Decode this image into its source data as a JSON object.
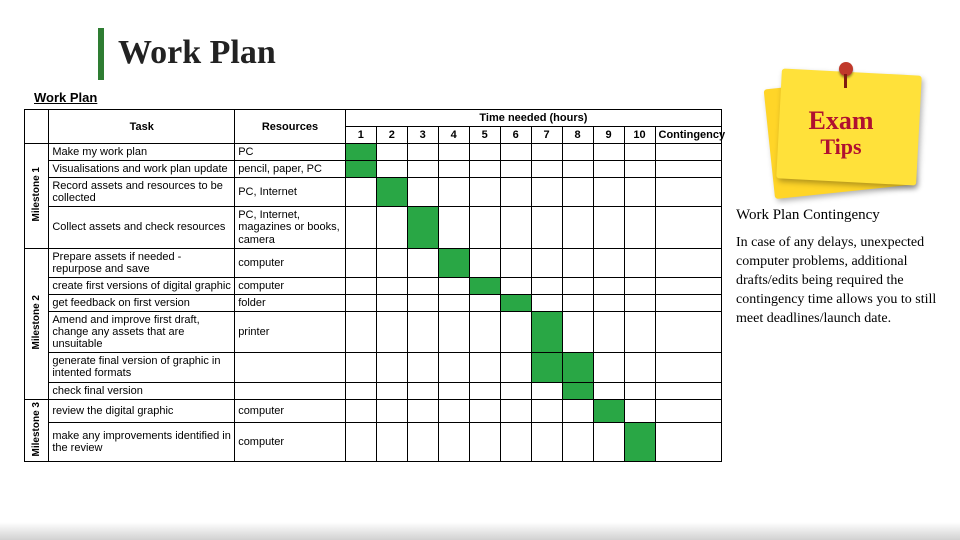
{
  "title": "Work Plan",
  "table_label": "Work Plan",
  "headers": {
    "task": "Task",
    "resources": "Resources",
    "time_group": "Time needed (hours)",
    "contingency": "Contingency",
    "hours": [
      "1",
      "2",
      "3",
      "4",
      "5",
      "6",
      "7",
      "8",
      "9",
      "10"
    ]
  },
  "milestones": [
    {
      "label": "Milestone 1",
      "start": 0,
      "span": 4
    },
    {
      "label": "Milestone 2",
      "start": 4,
      "span": 6
    },
    {
      "label": "Milestone 3",
      "start": 10,
      "span": 2
    }
  ],
  "rows": [
    {
      "task": "Make my work plan",
      "resource": "PC",
      "fill": [
        1
      ]
    },
    {
      "task": "Visualisations and work plan update",
      "resource": "pencil, paper, PC",
      "fill": [
        1
      ]
    },
    {
      "task": "Record assets and resources to be collected",
      "resource": "PC, Internet",
      "fill": [
        2
      ]
    },
    {
      "task": "Collect assets and check resources",
      "resource": "PC, Internet, magazines or books, camera",
      "fill": [
        3
      ]
    },
    {
      "task": "Prepare assets if needed - repurpose and save",
      "resource": "computer",
      "fill": [
        4
      ]
    },
    {
      "task": "create first versions of digital graphic",
      "resource": "computer",
      "fill": [
        5
      ]
    },
    {
      "task": "get feedback on first version",
      "resource": "folder",
      "fill": [
        6
      ]
    },
    {
      "task": "Amend and improve first draft, change any assets that are unsuitable",
      "resource": "printer",
      "fill": [
        7
      ]
    },
    {
      "task": "generate final version of graphic in intented formats",
      "resource": "",
      "fill": [
        7,
        8
      ]
    },
    {
      "task": "check final version",
      "resource": "",
      "fill": [
        8
      ]
    },
    {
      "task": "review the digital graphic",
      "resource": "computer",
      "fill": [
        9
      ]
    },
    {
      "task": "make any improvements identified in the review",
      "resource": "computer",
      "fill": [
        10
      ]
    }
  ],
  "sticky": {
    "line1": "Exam",
    "line2": "Tips"
  },
  "sidebar": {
    "heading": "Work Plan Contingency",
    "body": "In case of any delays, unexpected computer problems, additional drafts/edits being required the contingency time allows you to still meet deadlines/launch date."
  },
  "chart_data": {
    "type": "table",
    "title": "Work Plan",
    "columns": [
      "Task",
      "Resources",
      "1",
      "2",
      "3",
      "4",
      "5",
      "6",
      "7",
      "8",
      "9",
      "10",
      "Contingency"
    ],
    "milestones": {
      "Milestone 1": [
        "Make my work plan",
        "Visualisations and work plan update",
        "Record assets and resources to be collected",
        "Collect assets and check resources"
      ],
      "Milestone 2": [
        "Prepare assets if needed - repurpose and save",
        "create first versions of digital graphic",
        "get feedback on first version",
        "Amend and improve first draft, change any assets that are unsuitable",
        "generate final version of graphic in intented formats",
        "check final version"
      ],
      "Milestone 3": [
        "review the digital graphic",
        "make any improvements identified in the review"
      ]
    },
    "gantt": [
      {
        "task": "Make my work plan",
        "hours": [
          1
        ]
      },
      {
        "task": "Visualisations and work plan update",
        "hours": [
          1
        ]
      },
      {
        "task": "Record assets and resources to be collected",
        "hours": [
          2
        ]
      },
      {
        "task": "Collect assets and check resources",
        "hours": [
          3
        ]
      },
      {
        "task": "Prepare assets if needed - repurpose and save",
        "hours": [
          4
        ]
      },
      {
        "task": "create first versions of digital graphic",
        "hours": [
          5
        ]
      },
      {
        "task": "get feedback on first version",
        "hours": [
          6
        ]
      },
      {
        "task": "Amend and improve first draft, change any assets that are unsuitable",
        "hours": [
          7
        ]
      },
      {
        "task": "generate final version of graphic in intented formats",
        "hours": [
          7,
          8
        ]
      },
      {
        "task": "check final version",
        "hours": [
          8
        ]
      },
      {
        "task": "review the digital graphic",
        "hours": [
          9
        ]
      },
      {
        "task": "make any improvements identified in the review",
        "hours": [
          10
        ]
      }
    ]
  }
}
